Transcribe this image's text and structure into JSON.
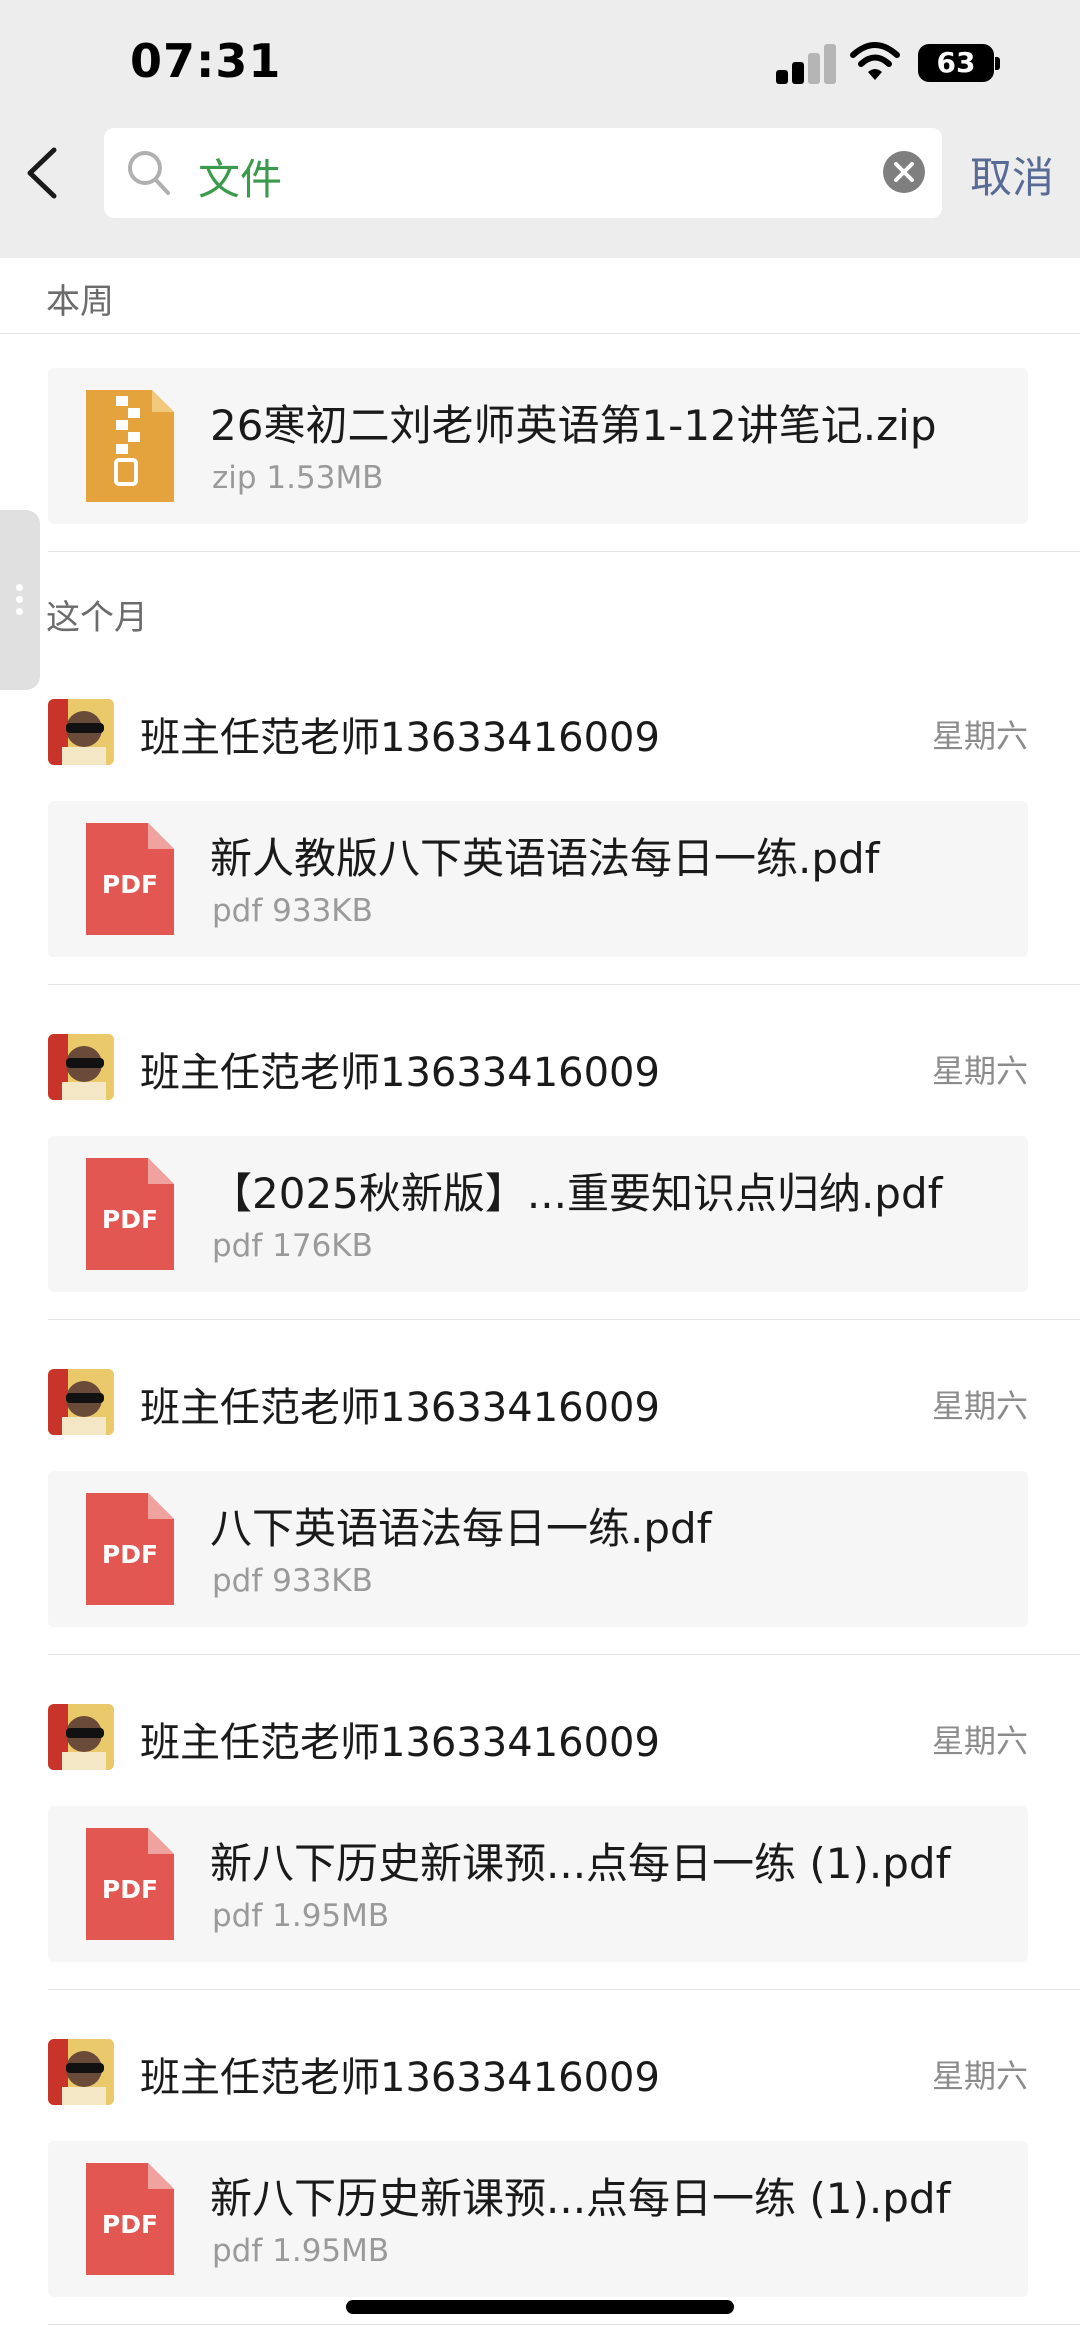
{
  "status_bar": {
    "time": "07:31",
    "battery": "63"
  },
  "header": {
    "back_icon": "chevron-left-icon",
    "search": {
      "icon": "search-icon",
      "value": "文件",
      "clear_icon": "clear-icon"
    },
    "cancel_label": "取消"
  },
  "colors": {
    "accent_green": "#3b9a4b",
    "link_blue": "#576b95",
    "zip_icon": "#e4a33c",
    "pdf_icon": "#e25752"
  },
  "sections": [
    {
      "title": "本周",
      "items": [
        {
          "file": {
            "type_icon": "zip-icon",
            "name": "26寒初二刘老师英语第1-12讲笔记.zip",
            "meta": "zip 1.53MB"
          }
        }
      ]
    },
    {
      "title": "这个月",
      "items": [
        {
          "sender": "班主任范老师13633416009",
          "date": "星期六",
          "file": {
            "type_icon": "pdf-icon",
            "icon_label": "PDF",
            "name": "新人教版八下英语语法每日一练.pdf",
            "meta": "pdf 933KB"
          }
        },
        {
          "sender": "班主任范老师13633416009",
          "date": "星期六",
          "file": {
            "type_icon": "pdf-icon",
            "icon_label": "PDF",
            "name": "【2025秋新版】...重要知识点归纳.pdf",
            "meta": "pdf 176KB"
          }
        },
        {
          "sender": "班主任范老师13633416009",
          "date": "星期六",
          "file": {
            "type_icon": "pdf-icon",
            "icon_label": "PDF",
            "name": "八下英语语法每日一练.pdf",
            "meta": "pdf 933KB"
          }
        },
        {
          "sender": "班主任范老师13633416009",
          "date": "星期六",
          "file": {
            "type_icon": "pdf-icon",
            "icon_label": "PDF",
            "name": "新八下历史新课预...点每日一练 (1).pdf",
            "meta": "pdf 1.95MB"
          }
        },
        {
          "sender": "班主任范老师13633416009",
          "date": "星期六",
          "file": {
            "type_icon": "pdf-icon",
            "icon_label": "PDF",
            "name": "新八下历史新课预...点每日一练 (1).pdf",
            "meta": "pdf 1.95MB"
          }
        }
      ]
    }
  ]
}
